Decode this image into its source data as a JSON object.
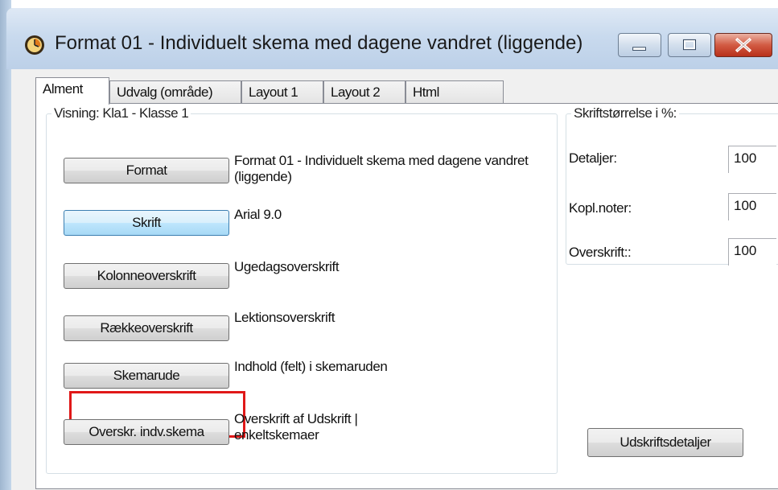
{
  "window": {
    "title": "Format 01 - Individuelt skema med dagene vandret (liggende)"
  },
  "tabs": [
    {
      "label": "Alment"
    },
    {
      "label": "Udvalg (område)"
    },
    {
      "label": "Layout 1"
    },
    {
      "label": "Layout 2"
    },
    {
      "label": "Html"
    }
  ],
  "visning": {
    "legend": "Visning: Kla1 - Klasse 1",
    "rows": [
      {
        "button": "Format",
        "desc": "Format 01 - Individuelt skema med dagene vandret (liggende)"
      },
      {
        "button": "Skrift",
        "desc": "Arial 9.0"
      },
      {
        "button": "Kolonneoverskrift",
        "desc": "Ugedagsoverskrift"
      },
      {
        "button": "Rækkeoverskrift",
        "desc": "Lektionsoverskrift"
      },
      {
        "button": "Skemarude",
        "desc": "Indhold (felt) i skemaruden"
      },
      {
        "button": "Overskr. indv.skema",
        "desc": "Overskrift af  Udskrift | enkeltskemaer"
      }
    ]
  },
  "skrift": {
    "legend": "Skriftstørrelse i %:",
    "fields": [
      {
        "label": "Detaljer:",
        "value": "100"
      },
      {
        "label": "Kopl.noter:",
        "value": "100"
      },
      {
        "label": "Overskrift::",
        "value": "100"
      }
    ]
  },
  "udskrift_button": "Udskriftsdetaljer",
  "colors": {
    "highlight_box": "#e01818",
    "hot_button": "#bee6fd",
    "close_button": "#c4432c"
  },
  "icons": {
    "app": "clock-icon",
    "minimize": "minimize-icon",
    "maximize": "maximize-icon",
    "close": "close-icon"
  }
}
